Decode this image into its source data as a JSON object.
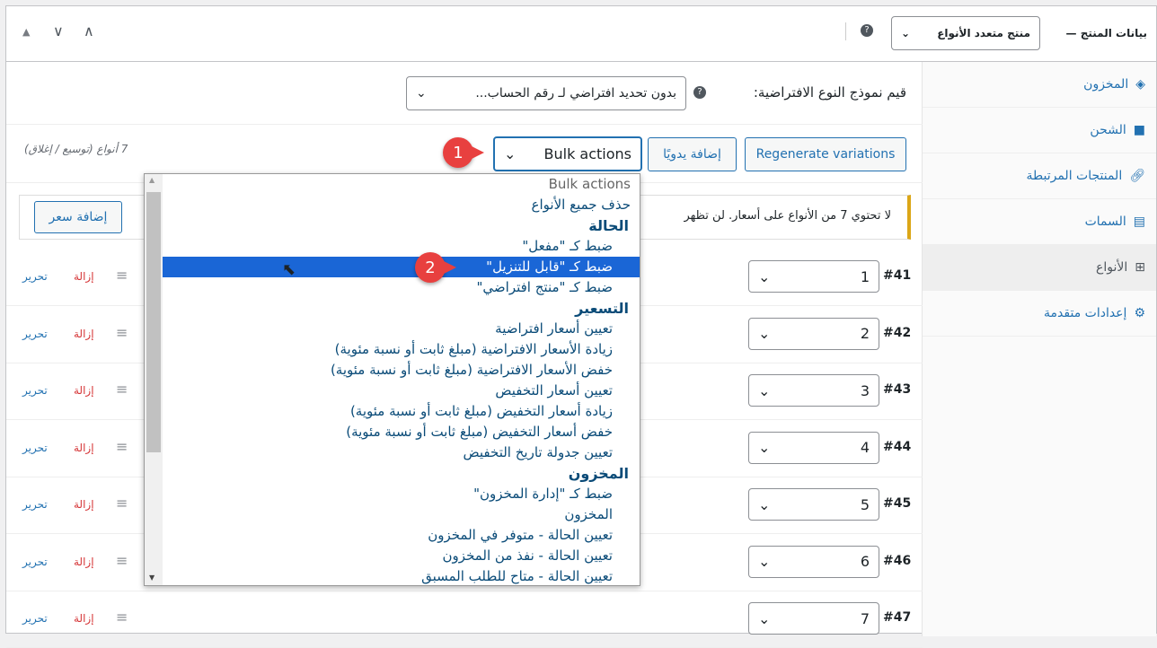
{
  "header": {
    "title": "بيانات المنتج —",
    "product_type": "منتج متعدد الأنواع"
  },
  "defaults": {
    "label": "قيم نموذج النوع الافتراضية:",
    "value": "بدون تحديد افتراضي لـ رقم الحساب..."
  },
  "toolbar": {
    "regenerate": "Regenerate variations",
    "add_manual": "إضافة يدويًا",
    "bulk": "Bulk actions",
    "count": "7 أنواع (توسيع / إغلاق)"
  },
  "notice": {
    "text": "لا تحتوي 7 من الأنواع على أسعار. لن تظهر",
    "add_price": "إضافة سعر"
  },
  "sidebar": [
    {
      "label": "المخزون"
    },
    {
      "label": "الشحن"
    },
    {
      "label": "المنتجات المرتبطة"
    },
    {
      "label": "السمات"
    },
    {
      "label": "الأنواع"
    },
    {
      "label": "إعدادات متقدمة"
    }
  ],
  "variations": [
    {
      "id": "#41",
      "value": "1"
    },
    {
      "id": "#42",
      "value": "2"
    },
    {
      "id": "#43",
      "value": "3"
    },
    {
      "id": "#44",
      "value": "4"
    },
    {
      "id": "#45",
      "value": "5"
    },
    {
      "id": "#46",
      "value": "6"
    },
    {
      "id": "#47",
      "value": "7"
    }
  ],
  "row_actions": {
    "edit": "تحرير",
    "remove": "إزالة"
  },
  "dropdown": [
    {
      "label": "Bulk actions",
      "kind": "first"
    },
    {
      "label": "حذف جميع الأنواع",
      "kind": "top"
    },
    {
      "label": "الحالة",
      "kind": "group"
    },
    {
      "label": "ضبط كـ \"مفعل\""
    },
    {
      "label": "ضبط كـ \"قابل للتنزيل\"",
      "kind": "hl"
    },
    {
      "label": "ضبط كـ \"منتج افتراضي\""
    },
    {
      "label": "التسعير",
      "kind": "group"
    },
    {
      "label": "تعيين أسعار افتراضية"
    },
    {
      "label": "زيادة الأسعار الافتراضية (مبلغ ثابت أو نسبة مئوية)"
    },
    {
      "label": "خفض الأسعار الافتراضية (مبلغ ثابت أو نسبة مئوية)"
    },
    {
      "label": "تعيين أسعار التخفيض"
    },
    {
      "label": "زيادة أسعار التخفيض (مبلغ ثابت أو نسبة مئوية)"
    },
    {
      "label": "خفض أسعار التخفيض (مبلغ ثابت أو نسبة مئوية)"
    },
    {
      "label": "تعيين جدولة تاريخ التخفيض"
    },
    {
      "label": "المخزون",
      "kind": "group"
    },
    {
      "label": "ضبط كـ \"إدارة المخزون\""
    },
    {
      "label": "المخزون"
    },
    {
      "label": "تعيين الحالة - متوفر في المخزون"
    },
    {
      "label": "تعيين الحالة - نفذ من المخزون"
    },
    {
      "label": "تعيين الحالة - متاح للطلب المسبق"
    }
  ],
  "badges": [
    "1",
    "2"
  ]
}
